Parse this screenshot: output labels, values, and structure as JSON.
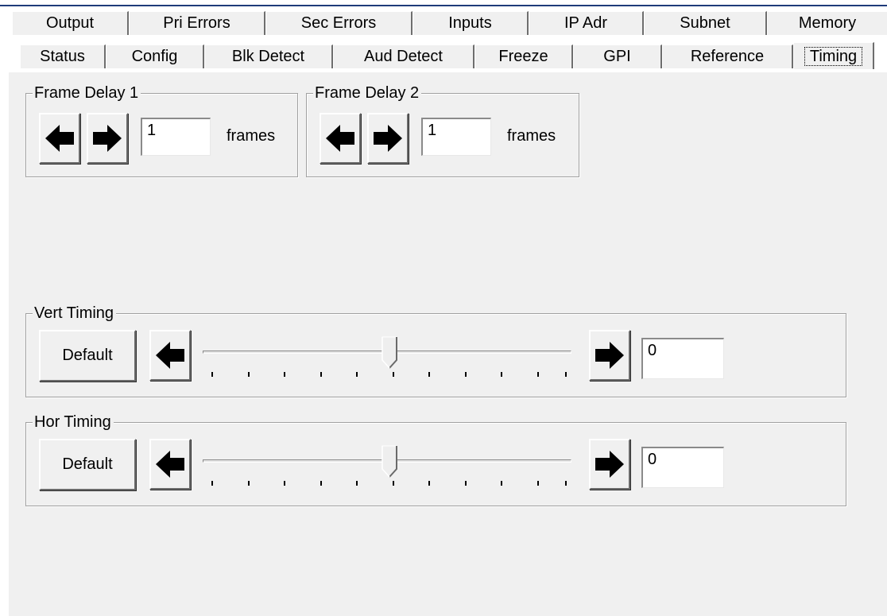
{
  "tabs": {
    "back_row": [
      {
        "label": "Output"
      },
      {
        "label": "Pri Errors"
      },
      {
        "label": "Sec Errors"
      },
      {
        "label": "Inputs"
      },
      {
        "label": "IP Adr"
      },
      {
        "label": "Subnet"
      },
      {
        "label": "Memory"
      }
    ],
    "front_row": [
      {
        "label": "Status"
      },
      {
        "label": "Config"
      },
      {
        "label": "Blk Detect"
      },
      {
        "label": "Aud Detect"
      },
      {
        "label": "Freeze"
      },
      {
        "label": "GPI"
      },
      {
        "label": "Reference"
      },
      {
        "label": "Timing",
        "selected": true
      }
    ]
  },
  "frame_delay_1": {
    "title": "Frame Delay 1",
    "value": "1",
    "unit": "frames"
  },
  "frame_delay_2": {
    "title": "Frame Delay 2",
    "value": "1",
    "unit": "frames"
  },
  "vert_timing": {
    "title": "Vert Timing",
    "default_label": "Default",
    "value": "0",
    "slider_fraction": 0.5
  },
  "hor_timing": {
    "title": "Hor Timing",
    "default_label": "Default",
    "value": "0",
    "slider_fraction": 0.5
  },
  "icons": {
    "left_arrow": "arrow-left-icon",
    "right_arrow": "arrow-right-icon"
  },
  "colors": {
    "panel_bg": "#f0f0f0",
    "accent_line": "#1f3b7a"
  }
}
